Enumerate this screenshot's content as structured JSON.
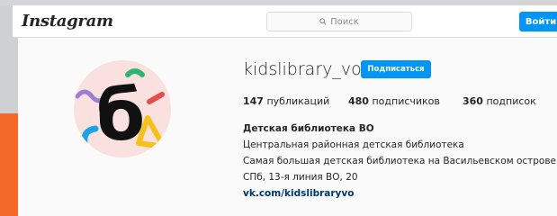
{
  "header": {
    "logo": "Instagram",
    "search_placeholder": "Поиск",
    "login_label": "Войти"
  },
  "profile": {
    "username": "kidslibrary_vo",
    "follow_label": "Подписаться",
    "stats": {
      "posts_count": "147",
      "posts_label": "публикаций",
      "followers_count": "480",
      "followers_label": "подписчиков",
      "following_count": "360",
      "following_label": "подписок"
    },
    "bio": {
      "name": "Детская библиотека ВО",
      "line1": "Центральная районная детская библиотека",
      "line2": "Самая большая детская библиотека на Васильевском острове",
      "line3": "СПб, 13-я линия ВО, 20",
      "link": "vk.com/kidslibraryvo"
    },
    "avatar_letter": "б"
  },
  "colors": {
    "accent": "#0095f6",
    "link": "#00376b",
    "avatar_bg": "#fbe0e0"
  }
}
